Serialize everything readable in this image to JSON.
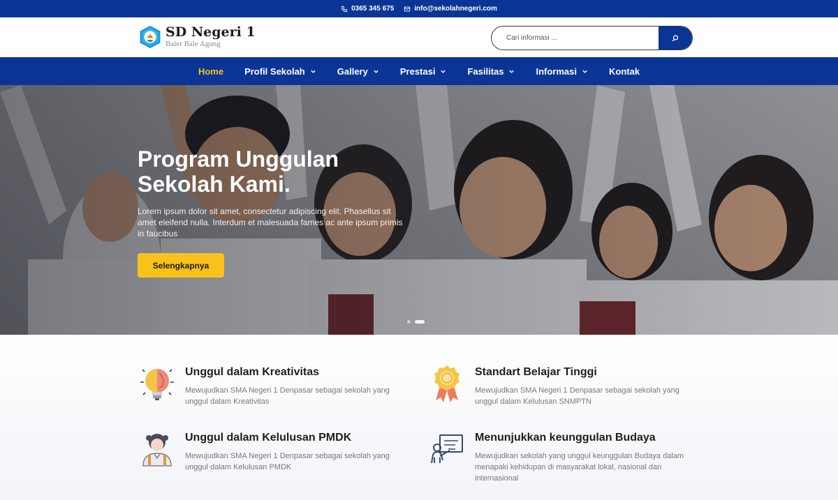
{
  "topbar": {
    "phone": "0365 345 675",
    "email": "info@sekolahnegeri.com"
  },
  "header": {
    "school_name": "SD Negeri 1",
    "school_sub": "Baler Bale Agung",
    "search_placeholder": "Cari informasi ..."
  },
  "nav": {
    "items": [
      {
        "label": "Home"
      },
      {
        "label": "Profil Sekolah"
      },
      {
        "label": "Gallery"
      },
      {
        "label": "Prestasi"
      },
      {
        "label": "Fasilitas"
      },
      {
        "label": "Informasi"
      },
      {
        "label": "Kontak"
      }
    ]
  },
  "hero": {
    "title": "Program Unggulan Sekolah Kami.",
    "description": "Lorem ipsum dolor sit amet, consectetur adipiscing elit. Phasellus sit amet eleifend nulla. Interdum et malesuada fames ac ante ipsum primis in faucibus",
    "button_label": "Selengkapnya"
  },
  "features": [
    {
      "title": "Unggul dalam Kreativitas",
      "text": "Mewujudkan SMA Negeri 1 Denpasar sebagai sekolah yang unggul dalam Kreativitas",
      "icon": "bulb-brain-icon"
    },
    {
      "title": "Standart Belajar Tinggi",
      "text": "Mewujudkan SMA Negeri 1 Denpasar sebagai sekolah yang unggul dalam Kelulusan SNMPTN",
      "icon": "award-medal-icon"
    },
    {
      "title": "Unggul dalam Kelulusan PMDK",
      "text": "Mewujudkan SMA Negeri 1 Denpasar sebagai sekolah yang unggul dalam Kelulusan PMDK",
      "icon": "student-icon"
    },
    {
      "title": "Menunjukkan keunggulan Budaya",
      "text": "Mewujudkan sekolah yang unggul keunggulan Budaya dalam menapaki kehidupan di masyarakat lokal, nasional dan internasional",
      "icon": "teacher-board-icon"
    }
  ],
  "colors": {
    "primary": "#0a3596",
    "accent": "#f9c21b"
  }
}
